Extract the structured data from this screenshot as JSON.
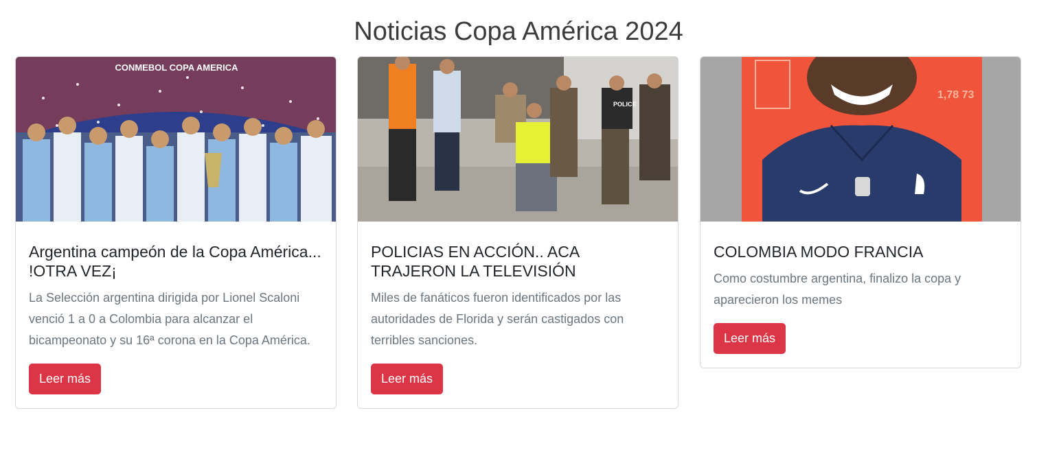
{
  "page": {
    "title": "Noticias Copa América 2024"
  },
  "cards": [
    {
      "title": "Argentina campeón de la Copa América... !OTRA VEZ¡",
      "text": "La Selección argentina dirigida por Lionel Scaloni venció 1 a 0 a Colombia para alcanzar el bicampeonato y su 16ª corona en la Copa América.",
      "button": "Leer más",
      "image_text": "CONMEBOL COPA AMERICA"
    },
    {
      "title": "POLICIAS EN ACCIÓN.. ACA TRAJERON LA TELEVISIÓN",
      "text": "Miles de fanáticos fueron identificados por las autoridades de Florida y serán castigados con terribles sanciones.",
      "button": "Leer más",
      "image_text": "POLICE"
    },
    {
      "title": "COLOMBIA MODO FRANCIA",
      "text": "Como costumbre argentina, finalizo la copa y aparecieron los memes",
      "button": "Leer más",
      "image_text": "1,78  73"
    }
  ],
  "colors": {
    "button": "#dc3545",
    "text_muted": "#6c757d"
  }
}
